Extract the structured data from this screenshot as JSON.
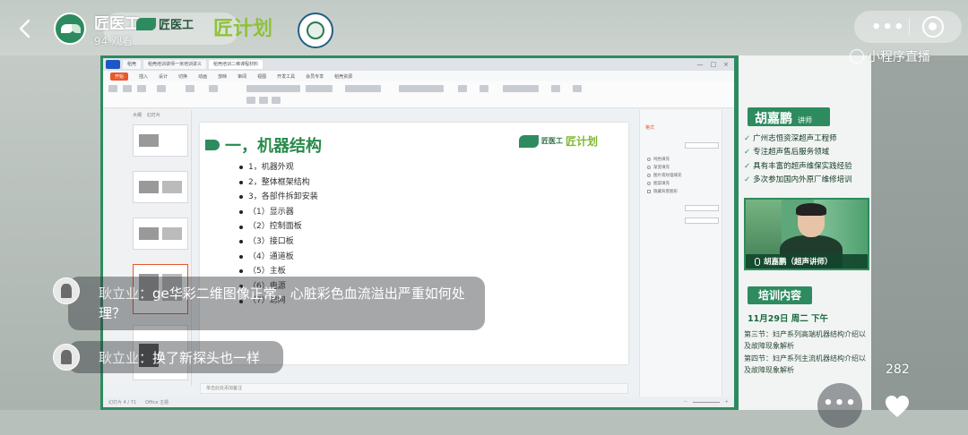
{
  "live": {
    "host_name": "匠医工…",
    "views": "94 观看",
    "banner_brand": "匠医工",
    "banner_plan": "匠计划",
    "mini_program_label": "小程序直播",
    "like_count": "282"
  },
  "wps": {
    "tabs": [
      "稻壳",
      "稻壳培训讲师一米培训讲义",
      "稻壳培训二维课程材料"
    ],
    "menu": [
      "开始",
      "插入",
      "设计",
      "切换",
      "动画",
      "放映",
      "审阅",
      "视图",
      "开发工具",
      "会员专享",
      "稻壳资源"
    ],
    "thumb_tabs": [
      "大纲",
      "幻灯片"
    ],
    "note_placeholder": "单击此处添加备注",
    "status_left": "幻灯片 4 / 71",
    "status_theme": "Office 主题",
    "props_title": "格式",
    "props_options": [
      "纯色填充",
      "渐变填充",
      "图片或纹理填充",
      "图案填充",
      "隐藏背景图形"
    ]
  },
  "slide": {
    "heading": "一，机器结构",
    "logo_text": "匠医工",
    "logo_plan": "匠计划",
    "items": [
      "1，机器外观",
      "2，整体框架结构",
      "3，各部件拆卸安装",
      "（1）显示器",
      "（2）控制面板",
      "（3）接口板",
      "（4）通道板",
      "（5）主板",
      "（6）电源",
      "（7）滤网"
    ]
  },
  "lecturer": {
    "name": "胡嘉鹏",
    "title": "讲师",
    "credentials": [
      "广州志恒资深超声工程师",
      "专注超声售后服务领域",
      "具有丰富的超声维保实践经验",
      "多次参加国内外原厂维修培训"
    ],
    "video_caption": "胡嘉鹏（超声讲师）"
  },
  "training": {
    "header": "培训内容",
    "date": "11月29日 周二 下午",
    "sections": [
      "第三节：妇产系列高端机器结构介绍以及故障现象解析",
      "第四节：妇产系列主流机器结构介绍以及故障现象解析"
    ]
  },
  "chat": [
    {
      "user": "耿立业：",
      "message": "ge华彩二维图像正常，心脏彩色血流溢出严重如何处理？"
    },
    {
      "user": "耿立业：",
      "message": "换了新探头也一样"
    }
  ],
  "colors": {
    "brand_green": "#2d8b5f",
    "accent_orange": "#e8582d"
  },
  "icons": [
    "back-icon",
    "more-icon",
    "close-icon",
    "mini-program-icon",
    "heart-icon",
    "microphone-icon",
    "check-icon"
  ]
}
